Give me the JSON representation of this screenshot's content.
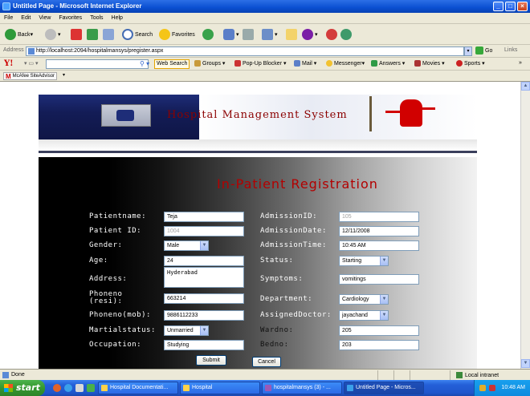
{
  "window": {
    "title": "Untitled Page - Microsoft Internet Explorer"
  },
  "menu": [
    "File",
    "Edit",
    "View",
    "Favorites",
    "Tools",
    "Help"
  ],
  "toolbar": {
    "back": "Back",
    "search": "Search",
    "favorites": "Favorites"
  },
  "address": {
    "label": "Address",
    "url": "http://localhost:2094/hospitalmansys/pregister.aspx",
    "go": "Go",
    "links": "Links"
  },
  "yahoo": {
    "logo": "Y!",
    "web_search": "Web Search",
    "items": [
      "Groups",
      "Pop-Up Blocker",
      "Mail",
      "Messenger",
      "Answers",
      "Movies",
      "Sports"
    ]
  },
  "favorites_bar": {
    "mcafee": "McAfee SiteAdvisor"
  },
  "banner": {
    "title": "Hospital Management System"
  },
  "form": {
    "title": "In-Patient Registration",
    "left": {
      "patientname": {
        "label": "Patientname:",
        "value": "Teja"
      },
      "patient_id": {
        "label": "Patient ID:",
        "value": "1004"
      },
      "gender": {
        "label": "Gender:",
        "value": "Male"
      },
      "age": {
        "label": "Age:",
        "value": "24"
      },
      "address": {
        "label": "Address:",
        "value": "Hyderabad"
      },
      "phone_resi": {
        "label_line1": "Phoneno",
        "label_line2": "(resi):",
        "value": "663214"
      },
      "phone_mob": {
        "label": "Phoneno(mob):",
        "value": "9886112233"
      },
      "marital": {
        "label": "Martialstatus:",
        "value": "Unmarried"
      },
      "occupation": {
        "label": "Occupation:",
        "value": "Studying"
      }
    },
    "right": {
      "admission_id": {
        "label": "AdmissionID:",
        "value": "105"
      },
      "admission_date": {
        "label": "AdmissionDate:",
        "value": "12/11/2008"
      },
      "admission_time": {
        "label": "AdmissionTime:",
        "value": "10:45 AM"
      },
      "status": {
        "label": "Status:",
        "value": "Starting"
      },
      "symptoms": {
        "label": "Symptoms:",
        "value": "vomitings"
      },
      "department": {
        "label": "Department:",
        "value": "Cardiology"
      },
      "assigned_doctor": {
        "label": "AssignedDoctor:",
        "value": "jayachand"
      },
      "wardno": {
        "label": "Wardno:",
        "value": "205"
      },
      "bedno": {
        "label": "Bedno:",
        "value": "203"
      }
    },
    "submit": "Submit",
    "cancel": "Cancel"
  },
  "status": {
    "text": "Done",
    "zone": "Local intranet"
  },
  "taskbar": {
    "start": "start",
    "tasks": [
      "Hospital Documentati...",
      "Hospital",
      "hospitalmansys (3) - ...",
      "Untitled Page - Micros..."
    ],
    "clock": "10:48 AM"
  },
  "icons": {
    "titlebar": "ie-icon",
    "dropdown": "chevron-down-icon"
  }
}
